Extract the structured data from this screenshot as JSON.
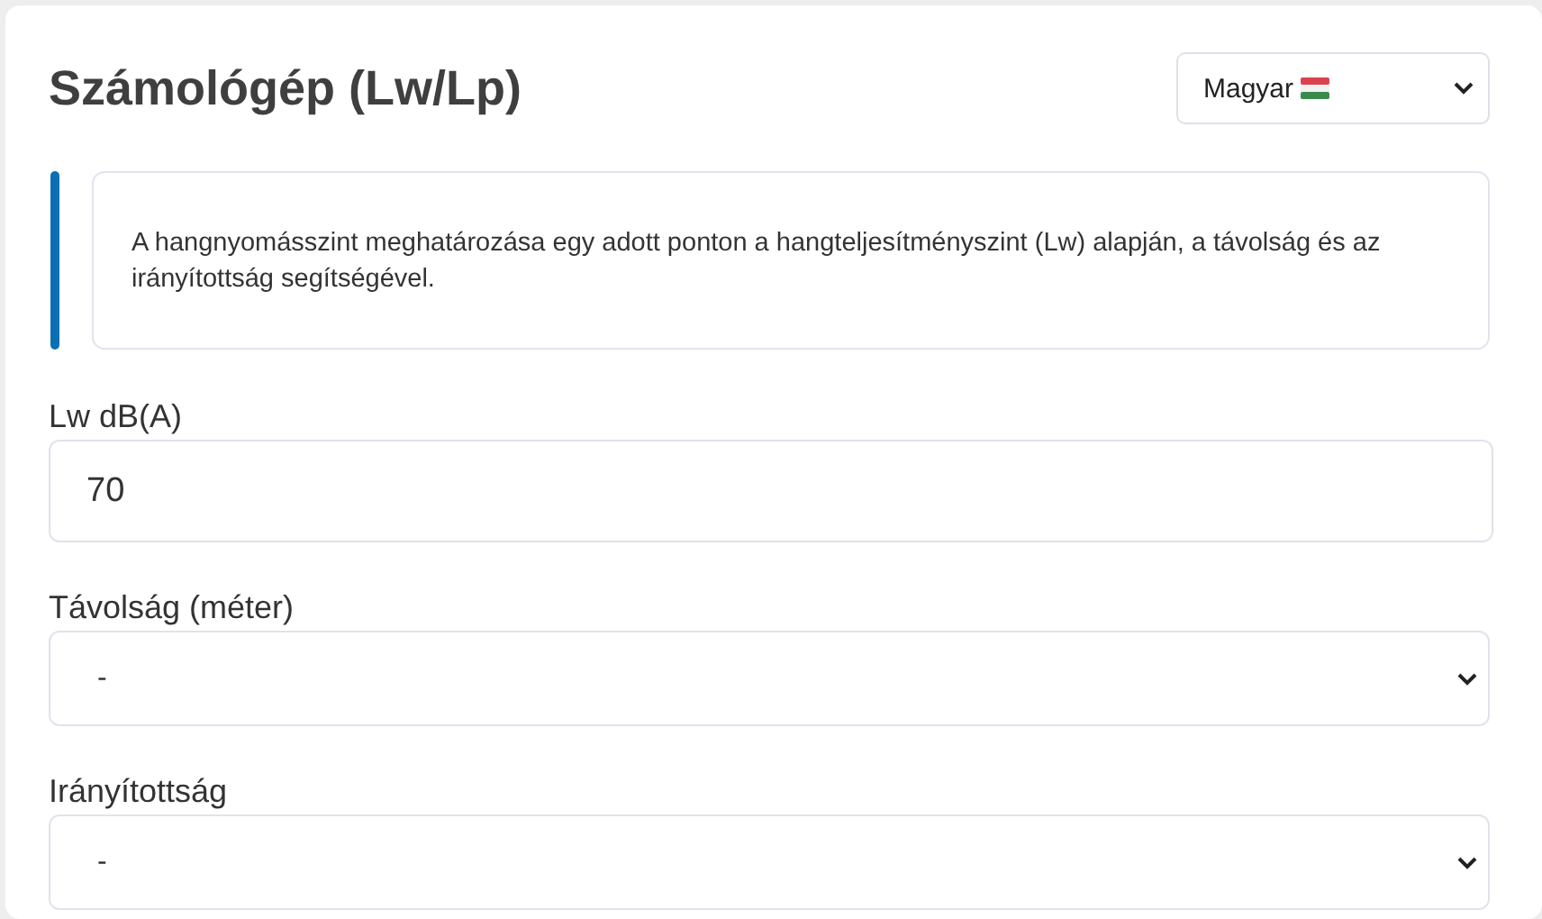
{
  "title": "Számológép (Lw/Lp)",
  "language": {
    "value": "Magyar"
  },
  "info": "A hangnyomásszint meghatározása egy adott ponton a hangteljesítményszint (Lw) alapján, a távolság és az irányítottság segítségével.",
  "fields": [
    {
      "kind": "input",
      "label": "Lw dB(A)",
      "value": "70"
    },
    {
      "kind": "select",
      "label": "Távolság (méter)",
      "value": "-"
    },
    {
      "kind": "select",
      "label": "Irányítottság",
      "value": "-"
    }
  ]
}
